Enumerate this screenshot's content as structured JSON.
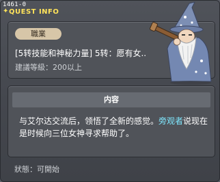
{
  "window": {
    "id_label": "1461-0",
    "title": "QUEST INFO"
  },
  "info": {
    "category": "職業",
    "quest_name": "[5转技能和神秘力量] 5转：愿有女..",
    "level_req": "建議等級：200以上"
  },
  "content": {
    "header": "内容",
    "text_part1": "与艾尔达交流后，领悟了全新的感觉。",
    "highlight": "旁观者",
    "text_part2": "说现在是时候向三位女神寻求帮助了。"
  },
  "status": "狀態：可開始",
  "colors": {
    "title": "#ffe35a",
    "highlight": "#7fe8ff",
    "badge": "#d7c6a8"
  },
  "icons": {
    "npc": "wizard-npc-portrait"
  }
}
